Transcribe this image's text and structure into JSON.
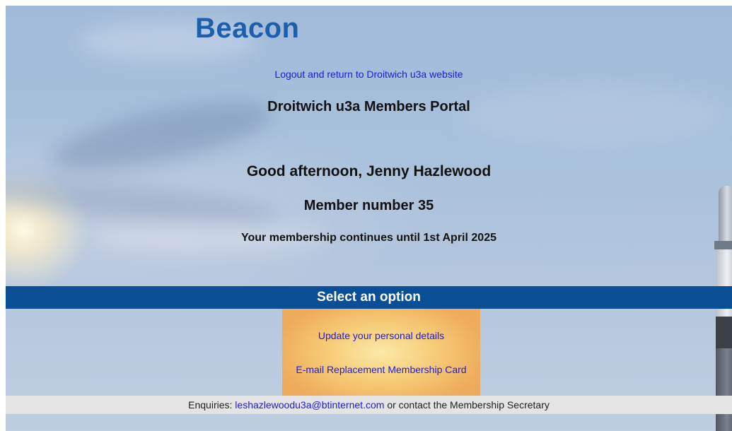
{
  "brand": {
    "logo_text": "Beacon",
    "color": "#1b5fae"
  },
  "header": {
    "logout_link": "Logout and return to Droitwich u3a website",
    "portal_title": "Droitwich u3a Members Portal"
  },
  "member": {
    "greeting": "Good afternoon, Jenny Hazlewood",
    "member_number": "Member number 35",
    "membership_status": "Your membership continues until 1st April 2025"
  },
  "options": {
    "heading": "Select an option",
    "heading_bg": "#0a4f96",
    "items": [
      {
        "label": "Update your personal details"
      },
      {
        "label": "E-mail Replacement Membership Card"
      }
    ]
  },
  "footer": {
    "prefix": "Enquiries:",
    "email": "leshazlewoodu3a@btinternet.com",
    "suffix": "or contact the Membership Secretary"
  },
  "colors": {
    "link": "#1a1ae6",
    "footer_bg": "#e4e4e4",
    "options_bg": "#f6c974"
  }
}
